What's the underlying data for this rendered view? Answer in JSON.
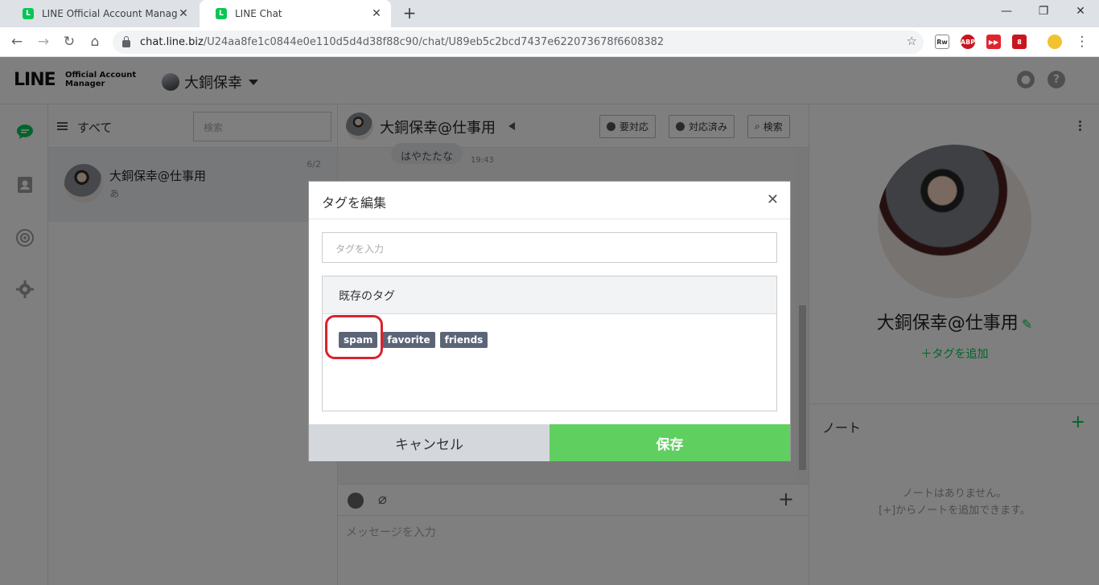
{
  "browser": {
    "tabs": [
      {
        "title": "LINE Official Account Manager",
        "active": false
      },
      {
        "title": "LINE Chat",
        "active": true
      }
    ],
    "url_host": "chat.line.biz",
    "url_path": "/U24aa8fe1c0844e0e110d5d4d38f88c90/chat/U89eb5c2bcd7437e622073678f6608382",
    "extension_badge": "8"
  },
  "header": {
    "logo": "LINE",
    "logo_sub_1": "Official Account",
    "logo_sub_2": "Manager",
    "account_name": "大銅保幸"
  },
  "chat_list": {
    "filter_label": "すべて",
    "search_placeholder": "検索",
    "items": [
      {
        "name": "大銅保幸@仕事用",
        "preview": "あ",
        "date": "6/2"
      }
    ]
  },
  "chat": {
    "title": "大銅保幸@仕事用",
    "buttons": {
      "needs_action": "要対応",
      "done": "対応済み",
      "search": "検索"
    },
    "last_message": "はやたたな",
    "last_time": "19:43",
    "compose_placeholder": "メッセージを入力"
  },
  "profile": {
    "name": "大銅保幸@仕事用",
    "add_tag": "＋タグを追加",
    "note_title": "ノート",
    "note_empty_1": "ノートはありません。",
    "note_empty_2": "[+]からノートを追加できます。"
  },
  "modal": {
    "title": "タグを編集",
    "input_placeholder": "タグを入力",
    "existing_tags_label": "既存のタグ",
    "tags": [
      "spam",
      "favorite",
      "friends"
    ],
    "cancel_label": "キャンセル",
    "save_label": "保存"
  },
  "colors": {
    "line_green": "#06c755",
    "save_green": "#5fcf5f",
    "tag_bg": "#5c6578",
    "highlight_red": "#d9232e"
  }
}
